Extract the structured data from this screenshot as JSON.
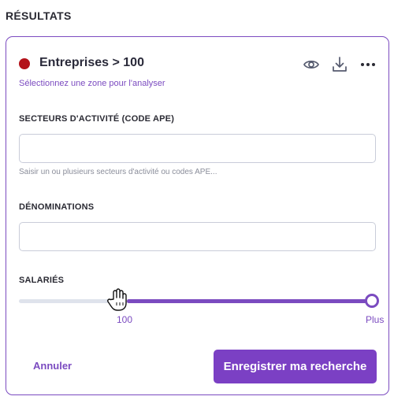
{
  "section_title": "RÉSULTATS",
  "card": {
    "status_color": "#b3121a",
    "title": "Entreprises > 100",
    "subtitle": "Sélectionnez une zone pour l'analyser",
    "icons": [
      "eye-icon",
      "download-icon",
      "more-options-icon"
    ]
  },
  "form": {
    "sectors": {
      "label": "SECTEURS D'ACTIVITÉ (CODE APE)",
      "value": "",
      "placeholder": "",
      "helper": "Saisir un ou plusieurs secteurs d'activité ou codes APE..."
    },
    "denominations": {
      "label": "DÉNOMINATIONS",
      "value": "",
      "placeholder": ""
    },
    "employees": {
      "label": "SALARIÉS",
      "min_label": "100",
      "max_label": "Plus",
      "range_start_fraction": 0.3,
      "range_end_fraction": 1.0
    }
  },
  "actions": {
    "cancel_label": "Annuler",
    "save_label": "Enregistrer ma recherche"
  },
  "colors": {
    "accent": "#7b4bc0",
    "button": "#7b40c4"
  }
}
